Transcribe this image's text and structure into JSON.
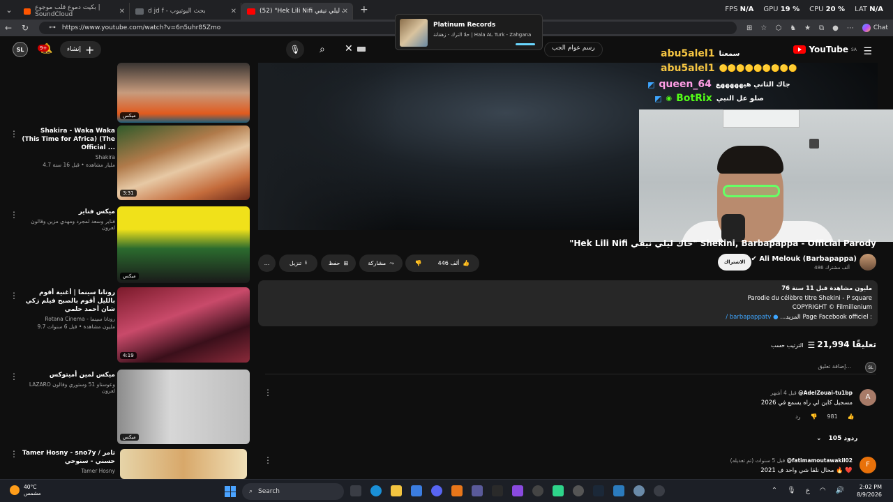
{
  "browser": {
    "tabs": [
      {
        "label": "بكيت دموع قلب موجوع | SoundCloud",
        "active": false,
        "color": "#ff5500"
      },
      {
        "label": "d jd f - بحث اليوتيوب",
        "active": false,
        "color": "#5f6368"
      },
      {
        "label": "(52) \"Hek Lili Nifi حاك ليلي نيفي\" Sh...",
        "active": true,
        "color": "#ff0000"
      }
    ],
    "stats": {
      "fps_label": "FPS",
      "fps": "N/A",
      "gpu_label": "GPU",
      "gpu": "19 %",
      "cpu_label": "CPU",
      "cpu": "20 %",
      "lat_label": "LAT",
      "lat": "N/A"
    },
    "url": "https://www.youtube.com/watch?v=6n5uhr85Zmo",
    "chat_label": "Chat"
  },
  "popup": {
    "title": "Platinum Records",
    "subtitle": "حلا الترك - زهقانة | Hala AL Turk - Zahgana"
  },
  "youtube": {
    "logo_text": "YouTube",
    "region": "SA",
    "search_text": "رسم عوام الجب",
    "create_label": "إنشاء",
    "notif_count": "9+",
    "avatar_initials": "SL"
  },
  "sidebar": [
    {
      "title": "",
      "channel": "",
      "stats": "",
      "badge": "ميكس"
    },
    {
      "title": "Shakira - Waka Waka (This Time for Africa) (The Official ...",
      "channel": "Shakira",
      "stats": "4.7 مليار مشاهدة • قبل 16 سنة",
      "badge": "3:31"
    },
    {
      "title": "ميكس فناير",
      "channel": "فناير وسعد لمجرد ومهدي مزين وقالون لعرون",
      "stats": "",
      "badge": "ميكس"
    },
    {
      "title": "روتانا سينما | أغنية أقوم بالليل أقوم بالصبح فيلم زكي شان أحمد حلمي",
      "channel": "Rotana Cinema - روتانا سينما",
      "stats": "9.7 مليون مشاهدة • قبل 6 سنوات",
      "badge": "4:19"
    },
    {
      "title": "ميكس لمين أميتوكس",
      "channel": "LAZARO وعوستاو 51 وستوري وقالون لعرون",
      "stats": "",
      "badge": "ميكس"
    },
    {
      "title": "Tamer Hosny - sno7y / تامر حسني - سنوحي",
      "channel": "Tamer Hosny",
      "stats": "",
      "badge": ""
    }
  ],
  "chat_overlay": [
    {
      "name": "abu5alel1",
      "msg": "سمعنا",
      "color": "#f5c542"
    },
    {
      "name": "abu5alel1",
      "msg": "🟡🟡🟡🟡🟡🟡🟡🟡🟡",
      "color": "#f5c542"
    },
    {
      "name": "queen_64",
      "msg": "جاك الثاني هيهههههع",
      "color": "#ff9ee6"
    },
    {
      "name": "BotRix",
      "msg": "صلو عل النبي",
      "color": "#53fc18"
    }
  ],
  "video": {
    "title": "\"Hek Lili Nifi حاك ليلي نيفي\" Shekini, Barbapappa - Official Parody",
    "channel": "Ali Melouk (Barbapappa)",
    "subs": "486 ألف مشترك",
    "subscribe_label": "الاشتراك",
    "likes": "446 ألف",
    "share_label": "مشاركة",
    "save_label": "حفظ",
    "download_label": "تنزيل",
    "more_label": "..."
  },
  "description": {
    "stats": "76 مليون مشاهدة قبل 11 سنة",
    "line1": "Parodie du célèbre titre Shekini - P square",
    "line2": "COPYRIGHT © Filmillenium",
    "line3_prefix": "...المزيد Page Facebook officiel :",
    "line3_link": "/ barbapappatv"
  },
  "comments": {
    "count": "21,994",
    "count_label": "تعليقًا",
    "sort_label": "الترتيب حسب",
    "add_placeholder": "إضافة تعليق...",
    "items": [
      {
        "author": "@AdelZouai-tu1bp",
        "time": "قبل 4 أشهر",
        "text": "مسجيل كاين لي راه يسمع في 2026",
        "likes": "981",
        "reply_label": "رد",
        "replies": "105 ردود",
        "initial": "A",
        "color": "#a87b68"
      },
      {
        "author": "@fatimamoutawakil02",
        "time": "قبل 5 سنوات (تم تعديله)",
        "text": "محال نلقا شي واحد ف 2021 🔥 ❤️",
        "likes": "",
        "reply_label": "",
        "replies": "",
        "initial": "F",
        "color": "#e8710a"
      }
    ]
  },
  "taskbar": {
    "temp": "40°C",
    "weather": "مشمس",
    "search_label": "Search",
    "time": "2:02 PM",
    "date": "8/9/2026"
  }
}
